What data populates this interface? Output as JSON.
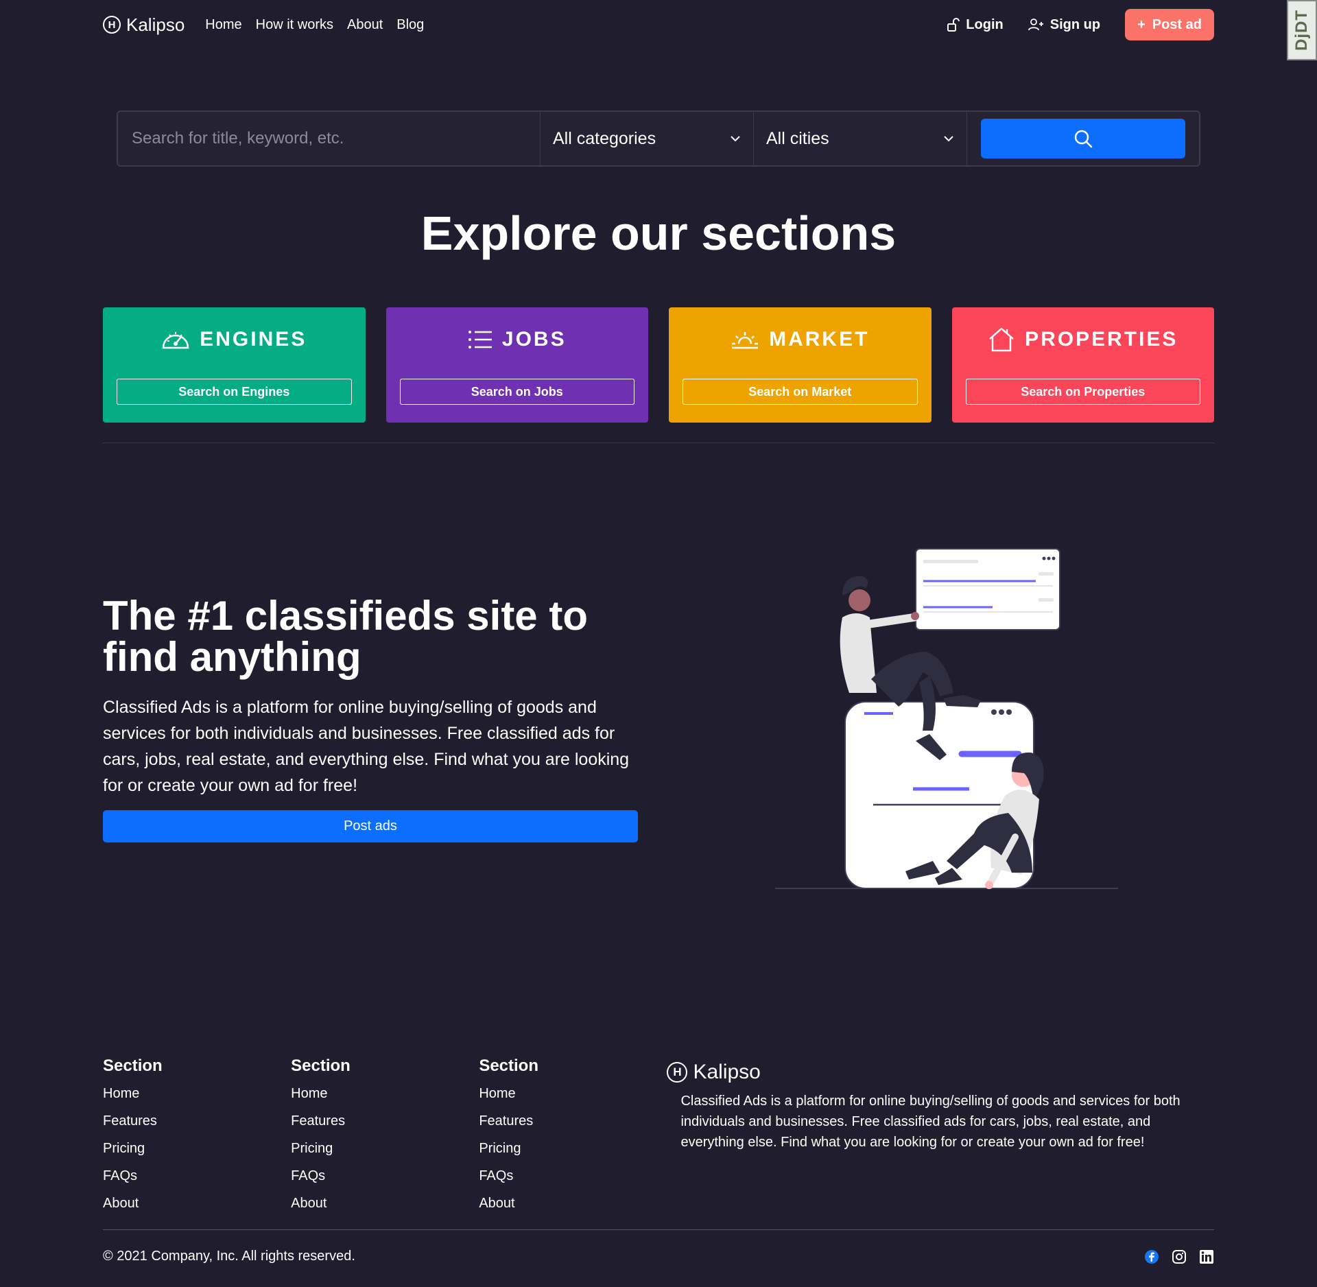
{
  "nav": {
    "brand": "Kalipso",
    "brand_mark": "H",
    "links": [
      "Home",
      "How it works",
      "About",
      "Blog"
    ],
    "login": "Login",
    "signup": "Sign up",
    "post_ad": "Post ad"
  },
  "debug_toolbar": {
    "label": "DjDT"
  },
  "search": {
    "placeholder": "Search for title, keyword, etc.",
    "category": "All categories",
    "city": "All cities"
  },
  "explore": {
    "title": "Explore our sections",
    "cards": [
      {
        "name": "ENGINES",
        "button": "Search on Engines",
        "color": "#06ad84",
        "icon": "speedometer-icon"
      },
      {
        "name": "JOBS",
        "button": "Search on Jobs",
        "color": "#7030b2",
        "icon": "list-icon"
      },
      {
        "name": "MARKET",
        "button": "Search on Market",
        "color": "#efa300",
        "icon": "sunrise-icon"
      },
      {
        "name": "PROPERTIES",
        "button": "Search on Properties",
        "color": "#fb4659",
        "icon": "house-icon"
      }
    ]
  },
  "hero": {
    "title": "The #1 classifieds site to find anything",
    "text": "Classified Ads is a platform for online buying/selling of goods and services for both individuals and businesses. Free classified ads for cars, jobs, real estate, and everything else. Find what you are looking for or create your own ad for free!",
    "button": "Post ads"
  },
  "footer": {
    "columns": [
      {
        "heading": "Section",
        "links": [
          "Home",
          "Features",
          "Pricing",
          "FAQs",
          "About"
        ]
      },
      {
        "heading": "Section",
        "links": [
          "Home",
          "Features",
          "Pricing",
          "FAQs",
          "About"
        ]
      },
      {
        "heading": "Section",
        "links": [
          "Home",
          "Features",
          "Pricing",
          "FAQs",
          "About"
        ]
      }
    ],
    "brand": "Kalipso",
    "description": "Classified Ads is a platform for online buying/selling of goods and services for both individuals and businesses. Free classified ads for cars, jobs, real estate, and everything else. Find what you are looking for or create your own ad for free!",
    "copyright": "© 2021 Company, Inc. All rights reserved.",
    "socials": [
      "facebook-icon",
      "instagram-icon",
      "linkedin-icon"
    ]
  },
  "colors": {
    "background": "#201d2e",
    "primary": "#0d6efd",
    "accent": "#fb7268"
  }
}
